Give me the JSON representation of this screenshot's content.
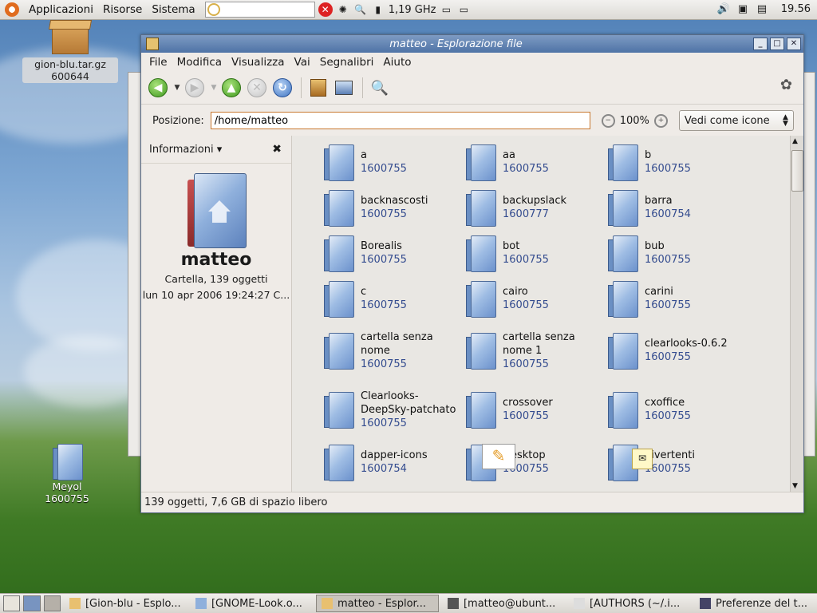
{
  "top_panel": {
    "menus": [
      "Applicazioni",
      "Risorse",
      "Sistema"
    ],
    "cpu_freq": "1,19 GHz",
    "clock": "19.56"
  },
  "desktop_icons": [
    {
      "label": "gion-blu.tar.gz",
      "sub": "600644"
    },
    {
      "label": "Meyol",
      "sub": "1600755"
    }
  ],
  "window": {
    "title": "matteo - Esplorazione file",
    "menu": [
      "File",
      "Modifica",
      "Visualizza",
      "Vai",
      "Segnalibri",
      "Aiuto"
    ],
    "location_label": "Posizione:",
    "location_value": "/home/matteo",
    "zoom": "100%",
    "view_mode": "Vedi come icone",
    "sidebar": {
      "header": "Informazioni",
      "name": "matteo",
      "info_line1": "Cartella, 139 oggetti",
      "info_line2": "lun 10 apr 2006 19:24:27 C..."
    },
    "files": [
      {
        "name": "a",
        "perm": "1600755"
      },
      {
        "name": "aa",
        "perm": "1600755"
      },
      {
        "name": "b",
        "perm": "1600755"
      },
      {
        "name": "backnascosti",
        "perm": "1600755"
      },
      {
        "name": "backupslack",
        "perm": "1600777"
      },
      {
        "name": "barra",
        "perm": "1600754"
      },
      {
        "name": "Borealis",
        "perm": "1600755"
      },
      {
        "name": "bot",
        "perm": "1600755"
      },
      {
        "name": "bub",
        "perm": "1600755"
      },
      {
        "name": "c",
        "perm": "1600755"
      },
      {
        "name": "cairo",
        "perm": "1600755"
      },
      {
        "name": "carini",
        "perm": "1600755"
      },
      {
        "name": "cartella senza nome",
        "perm": "1600755"
      },
      {
        "name": "cartella senza nome 1",
        "perm": "1600755"
      },
      {
        "name": "clearlooks-0.6.2",
        "perm": "1600755"
      },
      {
        "name": "Clearlooks-DeepSky-patchato",
        "perm": "1600755"
      },
      {
        "name": "crossover",
        "perm": "1600755"
      },
      {
        "name": "cxoffice",
        "perm": "1600755"
      },
      {
        "name": "dapper-icons",
        "perm": "1600754"
      },
      {
        "name": "Desktop",
        "perm": "1600755"
      },
      {
        "name": "divertenti",
        "perm": "1600755"
      }
    ],
    "status": "139 oggetti, 7,6 GB di spazio libero"
  },
  "taskbar": [
    {
      "label": "[Gion-blu - Esplo...",
      "active": false
    },
    {
      "label": "[GNOME-Look.o...",
      "active": false
    },
    {
      "label": "matteo - Esplor...",
      "active": true
    },
    {
      "label": "[matteo@ubunt...",
      "active": false
    },
    {
      "label": "[AUTHORS (~/.i...",
      "active": false
    },
    {
      "label": "Preferenze del t...",
      "active": false
    }
  ]
}
